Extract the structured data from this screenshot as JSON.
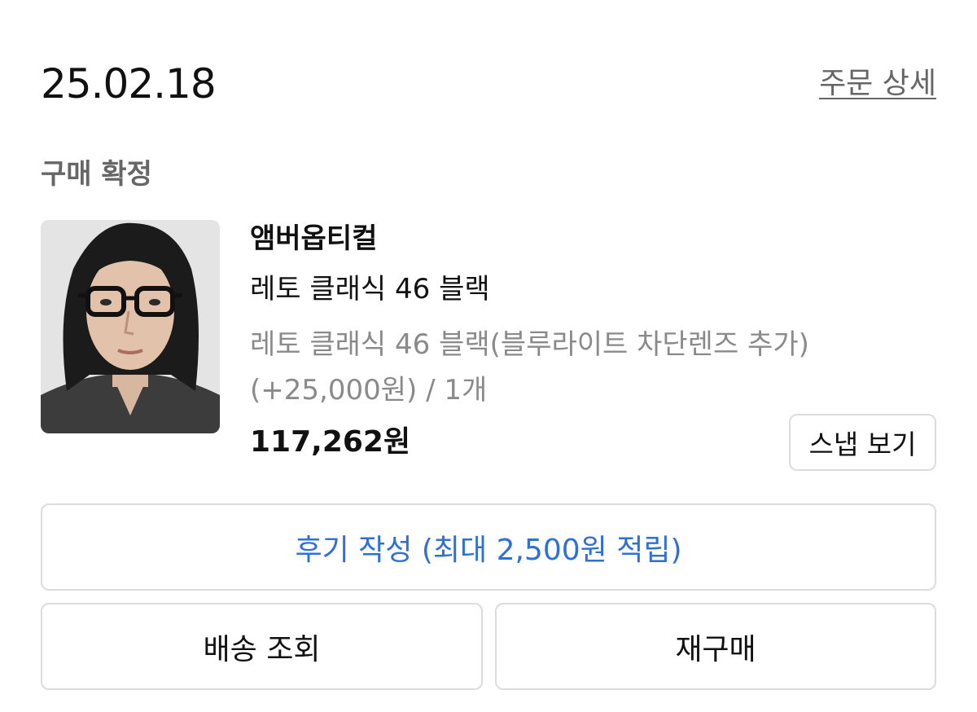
{
  "order": {
    "date": "25.02.18",
    "detail_link": "주문 상세",
    "status": "구매 확정"
  },
  "product": {
    "image_icon": "product-photo",
    "brand": "앰버옵티컬",
    "name": "레토 클래식 46 블랙",
    "option_line1": "레토 클래식 46 블랙(블루라이트 차단렌즈 추가)",
    "option_line2": "(+25,000원) / 1개",
    "price": "117,262원"
  },
  "actions": {
    "snap": "스냅 보기",
    "review": "후기 작성 (최대 2,500원 적립)",
    "delivery": "배송 조회",
    "rebuy": "재구매"
  },
  "colors": {
    "accent": "#2f6fd8",
    "muted_text": "#8a8a8a",
    "border": "#dcdcdc"
  }
}
